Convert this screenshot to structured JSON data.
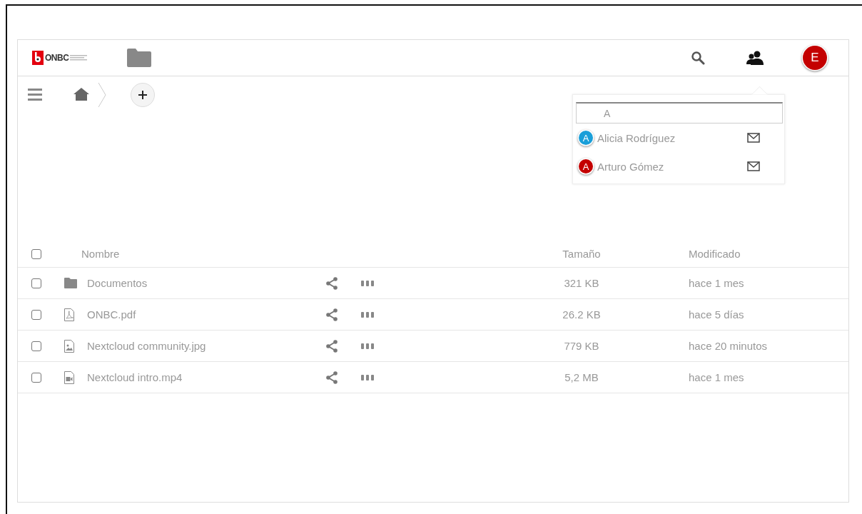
{
  "header": {
    "logo_text": "ONBC",
    "avatar_letter": "E"
  },
  "share_popup": {
    "search": {
      "value": "A"
    },
    "contacts": [
      {
        "initial": "A",
        "name": "Alicia Rodríguez",
        "color": "#1a9fd9"
      },
      {
        "initial": "A",
        "name": "Arturo Gómez",
        "color": "#c40000"
      }
    ]
  },
  "table": {
    "select_all": {
      "checked": false
    },
    "columns": {
      "name": "Nombre",
      "size": "Tamaño",
      "modified": "Modificado"
    },
    "rows": [
      {
        "kind": "folder",
        "name": "Documentos",
        "size": "321 KB",
        "modified": "hace 1 mes",
        "checked": false
      },
      {
        "kind": "pdf",
        "name": "ONBC.pdf",
        "size": "26.2 KB",
        "modified": "hace 5 días",
        "checked": false
      },
      {
        "kind": "image",
        "name": "Nextcloud community.jpg",
        "size": "779 KB",
        "modified": "hace 20 minutos",
        "checked": false
      },
      {
        "kind": "video",
        "name": "Nextcloud intro.mp4",
        "size": "5,2 MB",
        "modified": "hace 1 mes",
        "checked": false
      }
    ]
  }
}
